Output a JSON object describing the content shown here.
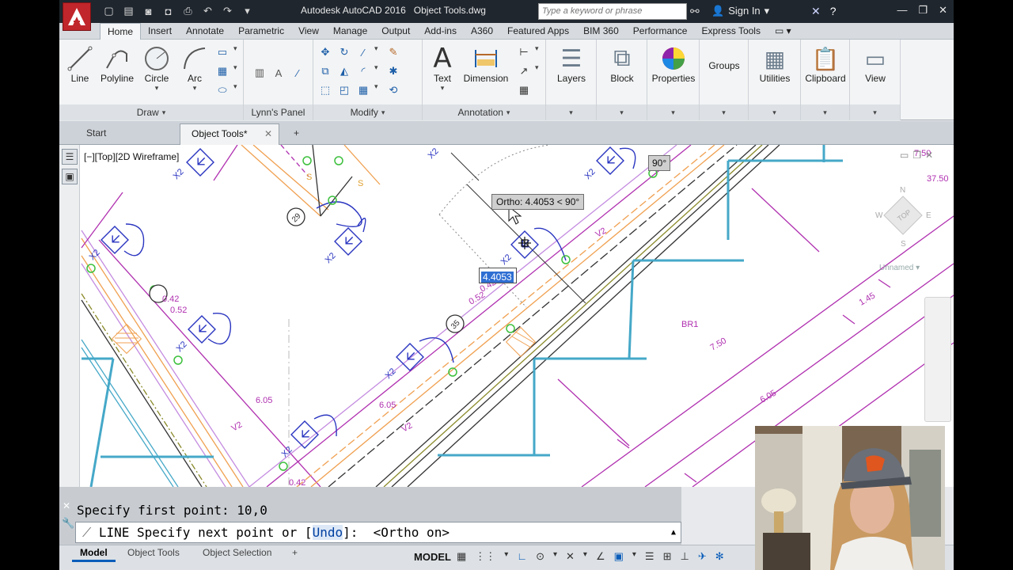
{
  "window": {
    "title": "Autodesk AutoCAD 2016",
    "document": "Object Tools.dwg",
    "search_placeholder": "Type a keyword or phrase",
    "sign_in": "Sign In"
  },
  "ribbon": {
    "tabs": [
      "Home",
      "Insert",
      "Annotate",
      "Parametric",
      "View",
      "Manage",
      "Output",
      "Add-ins",
      "A360",
      "Featured Apps",
      "BIM 360",
      "Performance",
      "Express Tools"
    ],
    "active_tab": "Home",
    "draw": {
      "line": "Line",
      "polyline": "Polyline",
      "circle": "Circle",
      "arc": "Arc",
      "footer": "Draw"
    },
    "lynns_panel": {
      "footer": "Lynn's Panel"
    },
    "modify": {
      "footer": "Modify"
    },
    "annotation": {
      "text": "Text",
      "dimension": "Dimension",
      "footer": "Annotation"
    },
    "layers": "Layers",
    "block": "Block",
    "properties": "Properties",
    "groups": "Groups",
    "utilities": "Utilities",
    "clipboard": "Clipboard",
    "view": "View"
  },
  "file_tabs": {
    "start": "Start",
    "object_tools": "Object Tools*"
  },
  "viewport": {
    "label": "[−][Top][2D Wireframe]",
    "ortho_tooltip": "Ortho: 4.4053 < 90°",
    "angle_tooltip": "90°",
    "distance_value": "4.4053",
    "unnamed": "Unnamed",
    "viewcube_label": "TOP",
    "drawing": {
      "room_label": "BR1",
      "dims": [
        "6.05",
        "6.05",
        "7.50",
        "6.05",
        "1.45",
        "7.50",
        "37.50",
        "0.42",
        "0.52",
        "0.42",
        "0.52",
        "0.42"
      ],
      "v2": "V2",
      "x2": "X2",
      "s": "S",
      "tags": [
        "29",
        "35"
      ]
    }
  },
  "command": {
    "history": "Specify first point: 10,0",
    "prompt_cmd": "LINE",
    "prompt_pre": " Specify next point or [",
    "prompt_opt": "Undo",
    "prompt_post": "]:  <Ortho on>"
  },
  "status": {
    "tabs": [
      "Model",
      "Object Tools",
      "Object Selection"
    ],
    "model": "MODEL"
  },
  "colors": {
    "accent": "#c0262b",
    "ortho_on": "#0b5dba"
  }
}
